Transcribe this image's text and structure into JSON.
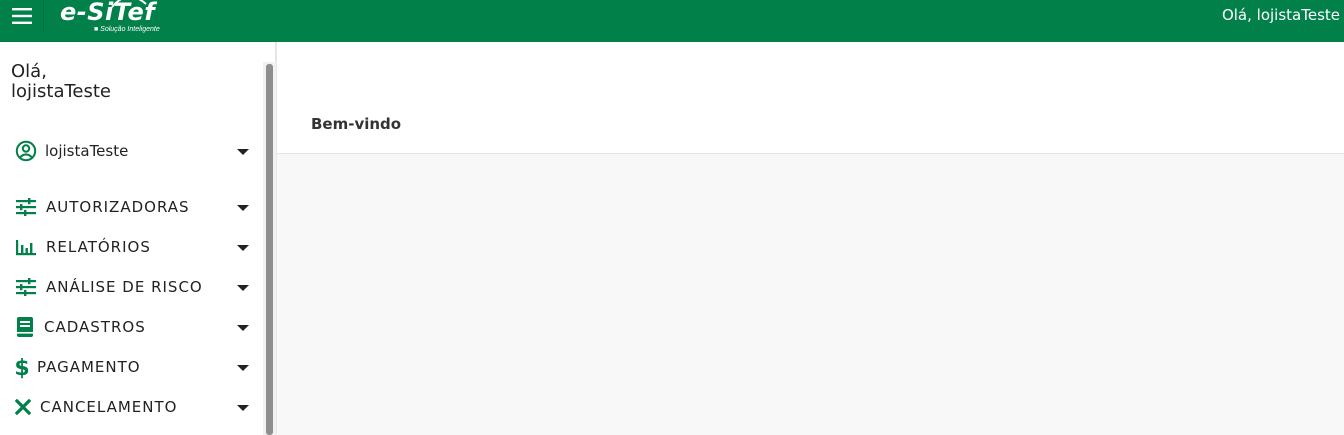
{
  "topbar": {
    "logo_text": "e-SiTef",
    "logo_tagline": "■ Solução Inteligente",
    "greeting": "Olá, lojistaTeste",
    "background_color": "#01804a"
  },
  "sidebar": {
    "greeting_line1": "Olá,",
    "greeting_line2": "lojistaTeste",
    "user_item": {
      "label": "lojistaTeste",
      "icon": "account-circle-icon"
    },
    "items": [
      {
        "label": "AUTORIZADORAS",
        "icon": "tune-icon"
      },
      {
        "label": "RELATÓRIOS",
        "icon": "bar-chart-icon"
      },
      {
        "label": "ANÁLISE DE RISCO",
        "icon": "tune-icon"
      },
      {
        "label": "CADASTROS",
        "icon": "book-icon"
      },
      {
        "label": "PAGAMENTO",
        "icon": "dollar-icon"
      },
      {
        "label": "CANCELAMENTO",
        "icon": "close-icon"
      }
    ],
    "icon_color": "#01804a"
  },
  "main": {
    "welcome_title": "Bem-vindo"
  }
}
